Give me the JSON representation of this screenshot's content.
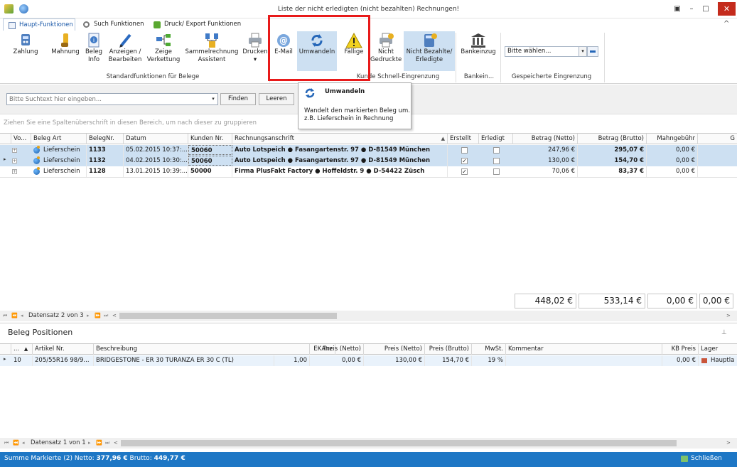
{
  "window": {
    "title": "Liste der nicht erledigten (nicht bezahlten) Rechnungen!",
    "close": "✕",
    "minimize": "–",
    "maximize": "□",
    "restore": "▣"
  },
  "tabs": [
    {
      "label": "Haupt-Funktionen"
    },
    {
      "label": "Such Funktionen"
    },
    {
      "label": "Druck/ Export Funktionen"
    }
  ],
  "ribbon": {
    "collapse": "^",
    "buttons": {
      "zahlung": "Zahlung",
      "mahnung": "Mahnung",
      "beleg_info_1": "Beleg",
      "beleg_info_2": "Info",
      "anzeigen_1": "Anzeigen /",
      "anzeigen_2": "Bearbeiten",
      "zeige_1": "Zeige",
      "zeige_2": "Verkettung",
      "sammel_1": "Sammelrechnung",
      "sammel_2": "Assistent",
      "drucken": "Drucken",
      "drucken_arrow": "▾",
      "email": "E-Mail",
      "umwandeln": "Umwandeln",
      "faellige": "Fällige",
      "nicht_1": "Nicht",
      "nicht_2": "Gedruckte",
      "nicht_bez_1": "Nicht Bezahlte/",
      "nicht_bez_2": "Erledigte",
      "bankeinzug": "Bankeinzug"
    },
    "groups": {
      "standard": "Standardfunktionen für Belege",
      "schnell": "Kunde Schnell-Eingrenzung",
      "bank": "Bankein...",
      "gespeichert": "Gespeicherte Eingrenzung"
    },
    "filter_select": "Bitte wählen..."
  },
  "tooltip": {
    "title": "Umwandeln",
    "text": "Wandelt den markierten Beleg um. z.B. Lieferschein in Rechnung"
  },
  "search": {
    "placeholder": "Bitte Suchtext hier eingeben...",
    "find": "Finden",
    "clear": "Leeren"
  },
  "group_hint": "Ziehen Sie eine Spaltenüberschrift in diesen Bereich, um nach dieser zu gruppieren",
  "grid": {
    "columns": [
      "Vo...",
      "Beleg Art",
      "BelegNr.",
      "Datum",
      "Kunden Nr.",
      "Rechnungsanschrift",
      "Erstellt",
      "Erledigt",
      "Betrag (Netto)",
      "Betrag (Brutto)",
      "Mahngebühr",
      "G"
    ],
    "sort_indicator": "▲",
    "rows": [
      {
        "art": "Lieferschein",
        "nr": "1133",
        "datum": "05.02.2015 10:37:...",
        "kunde": "50060",
        "anschrift": "Auto Lotspeich  ● Fasangartenstr. 97 ● D-81549 München",
        "erstellt": false,
        "erledigt": false,
        "netto": "247,96 €",
        "brutto": "295,07 €",
        "mahn": "0,00 €"
      },
      {
        "art": "Lieferschein",
        "nr": "1132",
        "datum": "04.02.2015 10:30:...",
        "kunde": "50060",
        "anschrift": "Auto Lotspeich  ● Fasangartenstr. 97 ● D-81549 München",
        "erstellt": true,
        "erledigt": false,
        "netto": "130,00 €",
        "brutto": "154,70 €",
        "mahn": "0,00 €"
      },
      {
        "art": "Lieferschein",
        "nr": "1128",
        "datum": "13.01.2015 10:39:...",
        "kunde": "50000",
        "anschrift": "Firma PlusFakt Factory  ● Hoffeldstr. 9 ● D-54422 Züsch",
        "erstellt": true,
        "erledigt": false,
        "netto": "70,06 €",
        "brutto": "83,37 €",
        "mahn": "0,00 €"
      }
    ],
    "totals": {
      "netto": "448,02 €",
      "brutto": "533,14 €",
      "mahn": "0,00 €",
      "extra": "0,00 €"
    },
    "nav_record": "Datensatz 2 von 3"
  },
  "positions": {
    "title": "Beleg Positionen",
    "pin": "⊥",
    "columns": [
      "...",
      "Artikel Nr.",
      "Beschreibung",
      "Anz",
      "EK Preis (Netto)",
      "Preis (Netto)",
      "Preis (Brutto)",
      "MwSt.",
      "Kommentar",
      "KB Preis",
      "Lager"
    ],
    "rows": [
      {
        "pos": "10",
        "artikel": "205/55R16 98/9...",
        "beschreibung": "BRIDGESTONE - ER 30 TURANZA ER 30 C (TL)",
        "anz": "1,00",
        "ek": "0,00 €",
        "netto": "130,00 €",
        "brutto": "154,70 €",
        "mwst": "19 %",
        "kommentar": "",
        "kb": "0,00 €",
        "lager": "Hauptla"
      }
    ],
    "nav_record": "Datensatz 1 von 1"
  },
  "status": {
    "prefix": "Summe Markierte (2) Netto: ",
    "netto": "377,96 €",
    "brutto_label": " Brutto: ",
    "brutto": "449,77 €",
    "close": "Schließen"
  },
  "colors": {
    "accent": "#1e77c5",
    "selection": "#cde0f2",
    "highlight": "#e81a1a"
  }
}
